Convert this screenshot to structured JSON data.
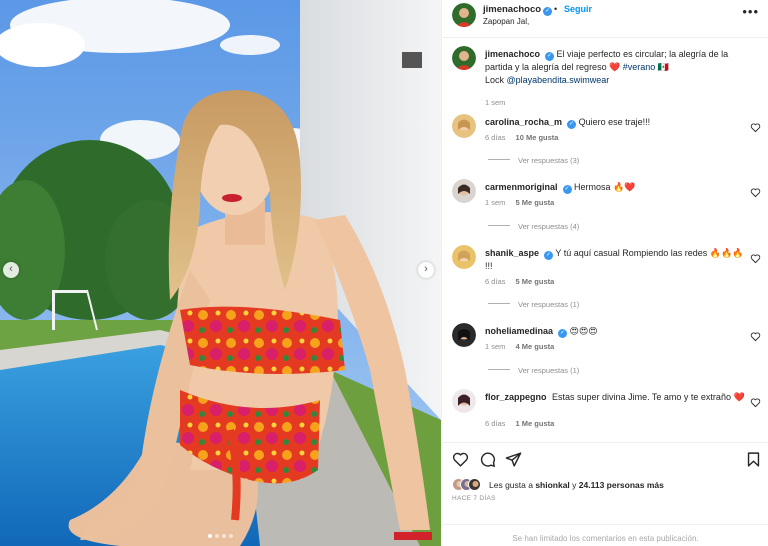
{
  "post": {
    "username": "jimenachoco",
    "separator": "•",
    "follow_label": "Seguir",
    "location": "Zapopan Jal,",
    "more_label": "•••",
    "prev_label": "‹",
    "next_label": "›"
  },
  "caption": {
    "username": "jimenachoco",
    "text_before": "El viaje perfecto es circular; la alegría de la partida y la alegría del regreso ❤️ ",
    "hashtag": "#verano",
    "flag": " 🇲🇽",
    "line2_prefix": "Lock ",
    "mention": "@playabendita.swimwear",
    "time": "1 sem"
  },
  "comments": [
    {
      "username": "carolina_rocha_m",
      "verified": true,
      "text": "Quiero ese traje!!!",
      "time": "6 días",
      "likes": "10 Me gusta",
      "replies": "Ver respuestas (3)"
    },
    {
      "username": "carmenmoriginal",
      "verified": true,
      "text": "Hermosa 🔥❤️",
      "time": "1 sem",
      "likes": "5 Me gusta",
      "replies": "Ver respuestas (4)"
    },
    {
      "username": "shanik_aspe",
      "verified": true,
      "text": "Y tú aquí casual Rompiendo las redes 🔥🔥🔥 !!!",
      "time": "6 días",
      "likes": "5 Me gusta",
      "replies": "Ver respuestas (1)"
    },
    {
      "username": "noheliamedinaa",
      "verified": true,
      "text": "😍😍😍",
      "time": "1 sem",
      "likes": "4 Me gusta",
      "replies": "Ver respuestas (1)"
    },
    {
      "username": "flor_zappegno",
      "verified": false,
      "text": "Estas super divina Jime. Te amo y te extraño ❤️",
      "time": "6 días",
      "likes": "1 Me gusta",
      "replies": ""
    }
  ],
  "likes_summary": {
    "prefix": "Les gusta a ",
    "user": "shionkal",
    "middle": " y ",
    "count": "24.113 personas más"
  },
  "posted_ago": "HACE 7 DÍAS",
  "comments_limited": "Se han limitado los comentarios en esta publicación.",
  "icons": {
    "like": "heart-icon",
    "comment": "comment-icon",
    "share": "share-icon",
    "save": "bookmark-icon",
    "more": "more-icon",
    "verified": "verified-badge-icon"
  },
  "colors": {
    "accent": "#0095f6",
    "verified": "#3897f0",
    "muted": "#8e8e8e",
    "text": "#262626",
    "link": "#00376b"
  },
  "carousel": {
    "slide_count": 4,
    "active_index": 0
  }
}
